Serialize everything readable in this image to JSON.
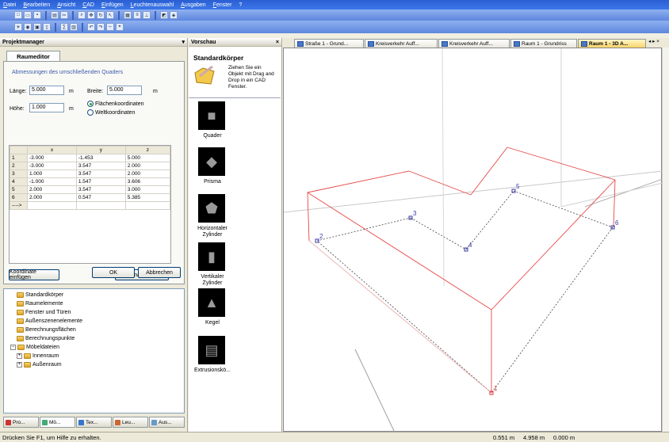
{
  "menu": [
    "Datei",
    "Bearbeiten",
    "Ansicht",
    "CAD",
    "Einfügen",
    "Leuchtenauswahl",
    "Ausgaben",
    "Fenster",
    "?"
  ],
  "left_pane": {
    "title": "Projektmanager",
    "tab": "Raumeditor",
    "group_title": "Abmessungen des umschließenden Quaders",
    "laenge_label": "Länge:",
    "laenge_value": "5.000",
    "laenge_unit": "m",
    "breite_label": "Breite:",
    "breite_value": "5.000",
    "breite_unit": "m",
    "hoehe_label": "Höhe:",
    "hoehe_value": "1.000",
    "hoehe_unit": "m",
    "radio_flaeche": "Flächenkoordinaten",
    "radio_welt": "Weltkoordinaten",
    "grid_headers": [
      "x",
      "y",
      "z"
    ],
    "grid_rows": [
      {
        "n": "1",
        "x": "-3.000",
        "y": "-1.453",
        "z": "5.000"
      },
      {
        "n": "2",
        "x": "-3.000",
        "y": "3.547",
        "z": "2.000"
      },
      {
        "n": "3",
        "x": "1.000",
        "y": "3.547",
        "z": "2.000"
      },
      {
        "n": "4",
        "x": "-1.000",
        "y": "1.547",
        "z": "3.606"
      },
      {
        "n": "5",
        "x": "2.000",
        "y": "3.547",
        "z": "3.000"
      },
      {
        "n": "6",
        "x": "2.000",
        "y": "0.547",
        "z": "5.385"
      }
    ],
    "new_row_marker": "---->",
    "btn_insert": "Koordinate einfügen",
    "btn_delete": "Koordinate löschen",
    "btn_ok": "OK",
    "btn_cancel": "Abbrechen",
    "tree": [
      {
        "label": "Standardkörper",
        "indent": 1
      },
      {
        "label": "Raumelemente",
        "indent": 1
      },
      {
        "label": "Fenster und Türen",
        "indent": 1
      },
      {
        "label": "Außenszenenelemente",
        "indent": 1
      },
      {
        "label": "Berechnungsflächen",
        "indent": 1
      },
      {
        "label": "Berechnungspunkte",
        "indent": 1
      },
      {
        "label": "Möbeldateien",
        "indent": 0
      },
      {
        "label": "Innenraum",
        "indent": 1
      },
      {
        "label": "Außenraum",
        "indent": 1
      }
    ],
    "bottom_tabs": [
      "Pro...",
      "Mö...",
      "Tex...",
      "Leu...",
      "Aus..."
    ]
  },
  "mid_pane": {
    "title": "Vorschau",
    "close": "×",
    "heading": "Standardkörper",
    "hint": "Ziehen Sie ein Objekt mit Drag and Drop in ein CAD Fenster.",
    "shapes": [
      "Quader",
      "Prisma",
      "Horizontaler Zylinder",
      "Vertikaler Zylinder",
      "Kegel",
      "Extrusionskö..."
    ]
  },
  "view_tabs": [
    {
      "label": "Straße 1 - Grund...",
      "active": false
    },
    {
      "label": "Kreisverkehr Auff...",
      "active": false
    },
    {
      "label": "Kreisverkehr Auff...",
      "active": false
    },
    {
      "label": "Raum 1 - Grundriss",
      "active": false
    },
    {
      "label": "Raum 1 - 3D A...",
      "active": true
    }
  ],
  "view_tab_arrows": "◂ ▸ ×",
  "viewport_points": [
    "1",
    "2",
    "3",
    "4",
    "5",
    "6"
  ],
  "status": {
    "help": "Drücken Sie F1, um Hilfe zu erhalten.",
    "x": "0.551 m",
    "y": "4.958 m",
    "z": "0.000 m"
  },
  "colors": {
    "outline": "#e84848",
    "dashed": "#444444",
    "point": "#3a3aa8",
    "titlebar": "#2a5fd4"
  }
}
